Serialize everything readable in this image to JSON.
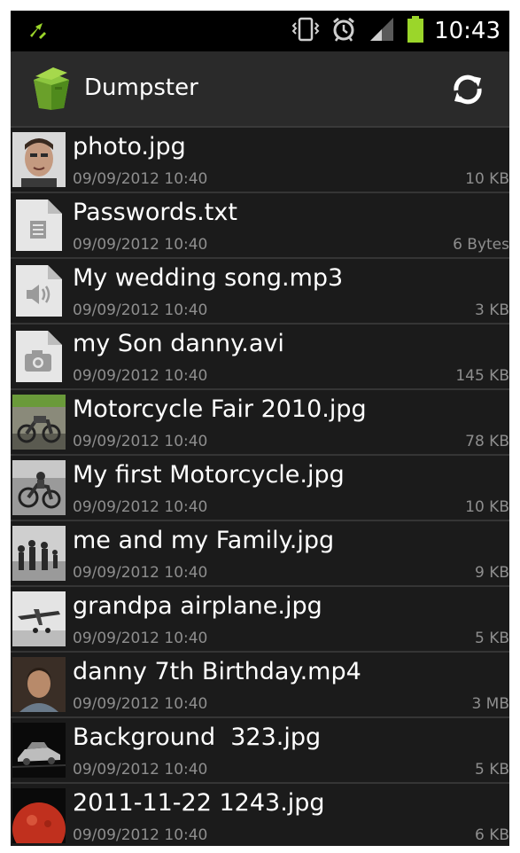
{
  "status_bar": {
    "time": "10:43",
    "icons": [
      "usb-debug-icon",
      "vibrate-icon",
      "alarm-icon",
      "signal-icon",
      "battery-icon"
    ],
    "battery_color": "#9bd62a"
  },
  "app_bar": {
    "title": "Dumpster",
    "logo_icon": "dumpster-logo-icon",
    "action_icon": "refresh-icon"
  },
  "files": [
    {
      "name": "photo.jpg",
      "date": "09/09/2012 10:40",
      "size": "10 KB",
      "thumb": "face-photo"
    },
    {
      "name": "Passwords.txt",
      "date": "09/09/2012 10:40",
      "size": "6 Bytes",
      "thumb": "text-file-icon"
    },
    {
      "name": "My wedding song.mp3",
      "date": "09/09/2012 10:40",
      "size": "3 KB",
      "thumb": "audio-file-icon"
    },
    {
      "name": "my Son danny.avi",
      "date": "09/09/2012 10:40",
      "size": "145 KB",
      "thumb": "video-file-icon"
    },
    {
      "name": "Motorcycle Fair 2010.jpg",
      "date": "09/09/2012 10:40",
      "size": "78 KB",
      "thumb": "motorcycle-photo"
    },
    {
      "name": "My first Motorcycle.jpg",
      "date": "09/09/2012 10:40",
      "size": "10 KB",
      "thumb": "motorcycle-bw-photo"
    },
    {
      "name": "me and my Family.jpg",
      "date": "09/09/2012 10:40",
      "size": "9 KB",
      "thumb": "family-photo"
    },
    {
      "name": "grandpa airplane.jpg",
      "date": "09/09/2012 10:40",
      "size": "5 KB",
      "thumb": "airplane-photo"
    },
    {
      "name": "danny 7th Birthday.mp4",
      "date": "09/09/2012 10:40",
      "size": "3 MB",
      "thumb": "portrait-photo"
    },
    {
      "name": "Background  323.jpg",
      "date": "09/09/2012 10:40",
      "size": "5 KB",
      "thumb": "car-dark-photo"
    },
    {
      "name": "2011-11-22 1243.jpg",
      "date": "09/09/2012 10:40",
      "size": "6 KB",
      "thumb": "red-planet-photo"
    }
  ]
}
